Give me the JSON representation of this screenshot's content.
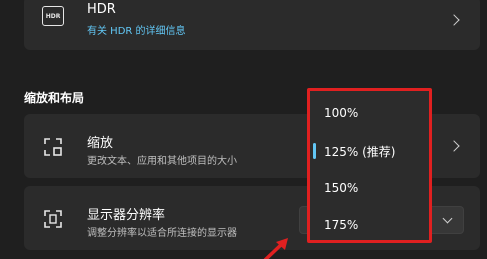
{
  "hdr_card": {
    "icon_label": "HDR",
    "title": "HDR",
    "link": "有关 HDR 的详细信息"
  },
  "section": {
    "title": "缩放和布局"
  },
  "scale_card": {
    "title": "缩放",
    "subtitle": "更改文本、应用和其他项目的大小"
  },
  "resolution_card": {
    "title": "显示器分辨率",
    "subtitle": "调整分辨率以适合所连接的显示器"
  },
  "scale_dropdown": {
    "options": [
      "100%",
      "125% (推荐)",
      "150%",
      "175%"
    ],
    "selected": "125% (推荐)"
  },
  "colors": {
    "accent": "#62c7f5",
    "highlight_box": "#e02020",
    "background": "#1f1f1f",
    "card": "#2b2b2b"
  }
}
